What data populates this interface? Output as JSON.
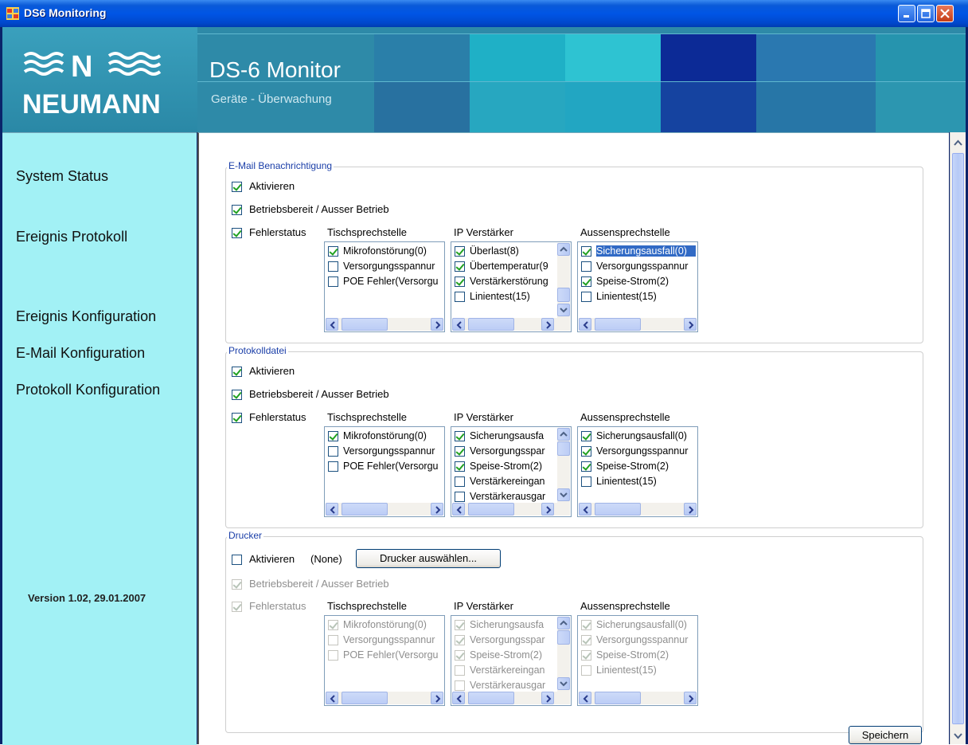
{
  "window": {
    "title": "DS6 Monitoring",
    "controls": [
      "minimize",
      "maximize",
      "close"
    ]
  },
  "header": {
    "logo_text": "NEUMANN",
    "title": "DS-6 Monitor",
    "subtitle": "Geräte - Überwachung"
  },
  "sidebar": {
    "items": [
      {
        "label": "System Status"
      },
      {
        "label": "Ereignis Protokoll"
      },
      {
        "label": "Ereignis Konfiguration"
      },
      {
        "label": "E-Mail Konfiguration"
      },
      {
        "label": "Protokoll Konfiguration"
      }
    ],
    "version": "Version 1.02,  29.01.2007"
  },
  "groups": [
    {
      "title": "E-Mail Benachrichtigung",
      "aktivieren": {
        "label": "Aktivieren",
        "checked": true
      },
      "betriebsbereit": {
        "label": "Betriebsbereit / Ausser Betrieb",
        "checked": true
      },
      "fehlerstatus": {
        "label": "Fehlerstatus",
        "checked": true
      },
      "columns": [
        {
          "header": "Tischsprechstelle",
          "items": [
            {
              "text": "Mikrofonstörung(0)",
              "checked": true
            },
            {
              "text": "Versorgungsspannur",
              "checked": false
            },
            {
              "text": "POE Fehler(Versorgu",
              "checked": false
            }
          ]
        },
        {
          "header": "IP Verstärker",
          "items": [
            {
              "text": "Überlast(8)",
              "checked": true
            },
            {
              "text": "Übertemperatur(9",
              "checked": true
            },
            {
              "text": "Verstärkerstörung",
              "checked": true
            },
            {
              "text": "Linientest(15)",
              "checked": false
            }
          ]
        },
        {
          "header": "Aussensprechstelle",
          "items": [
            {
              "text": "Sicherungsausfall(0)",
              "checked": true,
              "selected": true
            },
            {
              "text": "Versorgungsspannur",
              "checked": false
            },
            {
              "text": "Speise-Strom(2)",
              "checked": true
            },
            {
              "text": "Linientest(15)",
              "checked": false
            }
          ]
        }
      ]
    },
    {
      "title": "Protokolldatei",
      "aktivieren": {
        "label": "Aktivieren",
        "checked": true
      },
      "betriebsbereit": {
        "label": "Betriebsbereit / Ausser Betrieb",
        "checked": true
      },
      "fehlerstatus": {
        "label": "Fehlerstatus",
        "checked": true
      },
      "columns": [
        {
          "header": "Tischsprechstelle",
          "items": [
            {
              "text": "Mikrofonstörung(0)",
              "checked": true
            },
            {
              "text": "Versorgungsspannur",
              "checked": false
            },
            {
              "text": "POE Fehler(Versorgu",
              "checked": false
            }
          ]
        },
        {
          "header": "IP Verstärker",
          "items": [
            {
              "text": "Sicherungsausfa",
              "checked": true
            },
            {
              "text": "Versorgungsspar",
              "checked": true
            },
            {
              "text": "Speise-Strom(2)",
              "checked": true
            },
            {
              "text": "Verstärkereingan",
              "checked": false
            },
            {
              "text": "Verstärkerausgar",
              "checked": false
            }
          ]
        },
        {
          "header": "Aussensprechstelle",
          "items": [
            {
              "text": "Sicherungsausfall(0)",
              "checked": true
            },
            {
              "text": "Versorgungsspannur",
              "checked": true
            },
            {
              "text": "Speise-Strom(2)",
              "checked": true
            },
            {
              "text": "Linientest(15)",
              "checked": false
            }
          ]
        }
      ]
    },
    {
      "title": "Drucker",
      "aktivieren": {
        "label": "Aktivieren",
        "checked": false
      },
      "printer_value": "(None)",
      "select_button": "Drucker auswählen...",
      "betriebsbereit": {
        "label": "Betriebsbereit / Ausser Betrieb",
        "checked": true
      },
      "fehlerstatus": {
        "label": "Fehlerstatus",
        "checked": true
      },
      "columns": [
        {
          "header": "Tischsprechstelle",
          "items": [
            {
              "text": "Mikrofonstörung(0)",
              "checked": true
            },
            {
              "text": "Versorgungsspannur",
              "checked": false
            },
            {
              "text": "POE Fehler(Versorgu",
              "checked": false
            }
          ]
        },
        {
          "header": "IP Verstärker",
          "items": [
            {
              "text": "Sicherungsausfa",
              "checked": true
            },
            {
              "text": "Versorgungsspar",
              "checked": true
            },
            {
              "text": "Speise-Strom(2)",
              "checked": true
            },
            {
              "text": "Verstärkereingan",
              "checked": false
            },
            {
              "text": "Verstärkerausgar",
              "checked": false
            }
          ]
        },
        {
          "header": "Aussensprechstelle",
          "items": [
            {
              "text": "Sicherungsausfall(0)",
              "checked": true
            },
            {
              "text": "Versorgungsspannur",
              "checked": true
            },
            {
              "text": "Speise-Strom(2)",
              "checked": true
            },
            {
              "text": "Linientest(15)",
              "checked": false
            }
          ]
        }
      ]
    }
  ],
  "save_button": "Speichern",
  "colors": {
    "titlebar": "#0055e5",
    "sidebar": "#a2f1f5",
    "banner": "#2e8aa8",
    "group_title": "#1a3ea8"
  }
}
